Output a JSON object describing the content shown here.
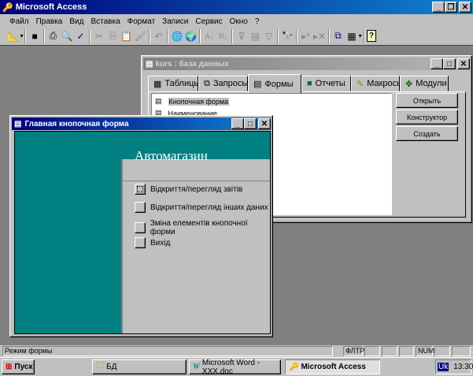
{
  "app": {
    "title": "Microsoft Access"
  },
  "menu": [
    "Файл",
    "Правка",
    "Вид",
    "Вставка",
    "Формат",
    "Записи",
    "Сервис",
    "Окно",
    "?"
  ],
  "toolbar": {
    "icons": [
      "design-view-icon",
      "save-icon",
      "print-icon",
      "print-preview-icon",
      "spelling-icon",
      "cut-icon",
      "copy-icon",
      "paste-icon",
      "format-painter-icon",
      "undo-icon",
      "insert-hyperlink-icon",
      "web-toolbar-icon",
      "sort-ascending-icon",
      "sort-descending-icon",
      "filter-by-selection-icon",
      "filter-by-form-icon",
      "apply-filter-icon",
      "find-icon",
      "new-record-icon",
      "delete-record-icon",
      "database-window-icon",
      "new-object-icon",
      "help-icon"
    ]
  },
  "db_window": {
    "title": "kurs : база данных",
    "tabs": [
      {
        "label": "Таблицы"
      },
      {
        "label": "Запросы"
      },
      {
        "label": "Формы"
      },
      {
        "label": "Отчеты"
      },
      {
        "label": "Макросы"
      },
      {
        "label": "Модули"
      }
    ],
    "active_tab": "Формы",
    "items": [
      "Кнопочная форма",
      "Наименование"
    ],
    "buttons": {
      "open": "Открыть",
      "design": "Конструктор",
      "create": "Создать"
    }
  },
  "form_window": {
    "title": "Главная кнопочная форма",
    "heading": "Автомагазин",
    "commands": [
      "Відкриття/перегляд звітів",
      "Відкриття/перегляд інших даних",
      "Зміна елементів кнопочної форми",
      "Вихід"
    ],
    "colors": {
      "background": "#008080",
      "panel": "#c0c0c0"
    }
  },
  "status": {
    "text": "Режим формы",
    "filter": "ФЛТР",
    "num": "NUM"
  },
  "taskbar": {
    "start": "Пуск",
    "tasks": [
      "БД",
      "Microsoft Word - XXX.doc",
      "Microsoft Access"
    ],
    "lang": "Uk",
    "time": "13:30"
  }
}
